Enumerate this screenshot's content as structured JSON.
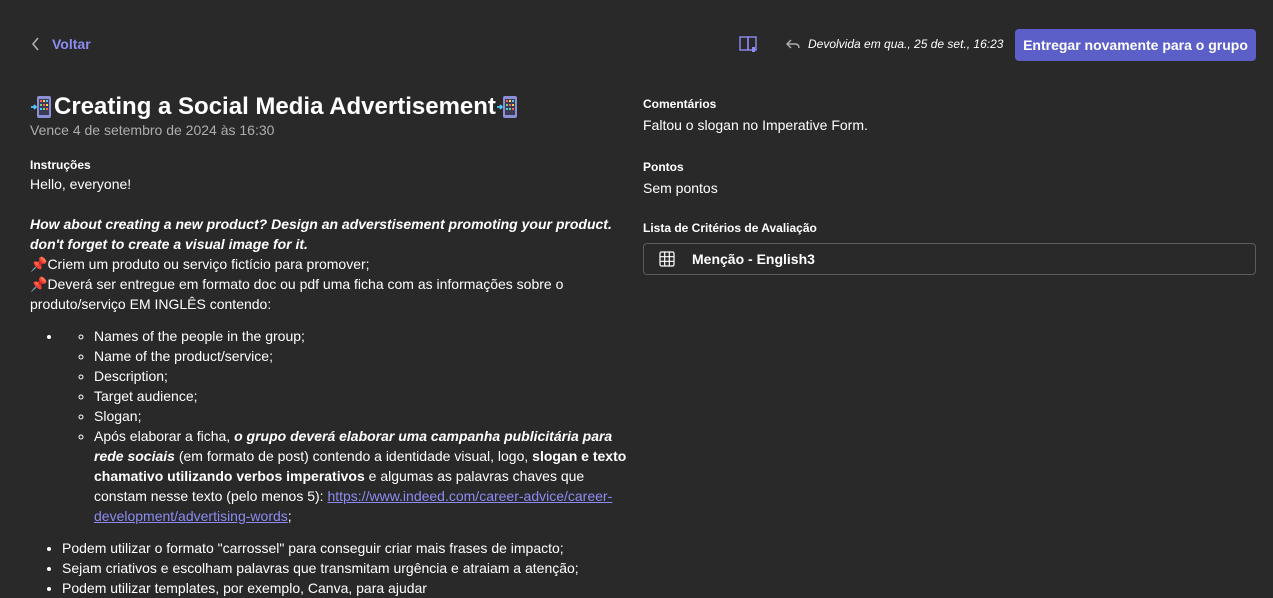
{
  "topbar": {
    "back_label": "Voltar",
    "returned_text": "Devolvida em qua., 25 de set., 16:23",
    "resubmit_label": "Entregar novamente para o grupo"
  },
  "assignment": {
    "title": "Creating a Social Media Advertisement",
    "due": "Vence 4 de setembro de 2024 às 16:30",
    "instructions_label": "Instruções",
    "greeting": "Hello, everyone!",
    "prompt_line1": "How about creating a new product? Design an adverstisement promoting your product.",
    "prompt_line2": "don't forget to create a visual image for it.",
    "pin1_text": "Criem um produto ou serviço fictício para promover;",
    "pin2_text": "Deverá ser entregue em formato doc ou pdf uma ficha com as informações sobre o produto/serviço EM INGLÊS contendo:",
    "items": [
      "Names of the people in the group;",
      "Name of the product/service;",
      "Description;",
      "Target audience;",
      "Slogan;"
    ],
    "last_item": {
      "part1": "Após elaborar a ficha, ",
      "part2": "o grupo deverá elaborar uma campanha publicitária para rede sociais",
      "part3": " (em formato de post) contendo a identidade visual, logo, ",
      "part4": "slogan e texto chamativo utilizando verbos imperativos",
      "part5": " e algumas as palavras chaves que constam nesse texto (pelo menos 5): ",
      "link": "https://www.indeed.com/career-advice/career-development/advertising-words",
      "part6": ";"
    },
    "tips": [
      "Podem utilizar o formato \"carrossel\" para conseguir criar mais frases de impacto;",
      "Sejam criativos e escolham palavras que transmitam urgência e atraiam a atenção;",
      "Podem utilizar templates, por exemplo, Canva, para ajudar"
    ]
  },
  "sidebar": {
    "comments_label": "Comentários",
    "comment_text": "Faltou o slogan no Imperative Form.",
    "points_label": "Pontos",
    "points_value": "Sem pontos",
    "rubric_label": "Lista de Critérios de Avaliação",
    "rubric_name": "Menção - English3"
  },
  "colors": {
    "background": "#292929",
    "accent": "#5b5fc7",
    "link": "#8b8cf2"
  }
}
